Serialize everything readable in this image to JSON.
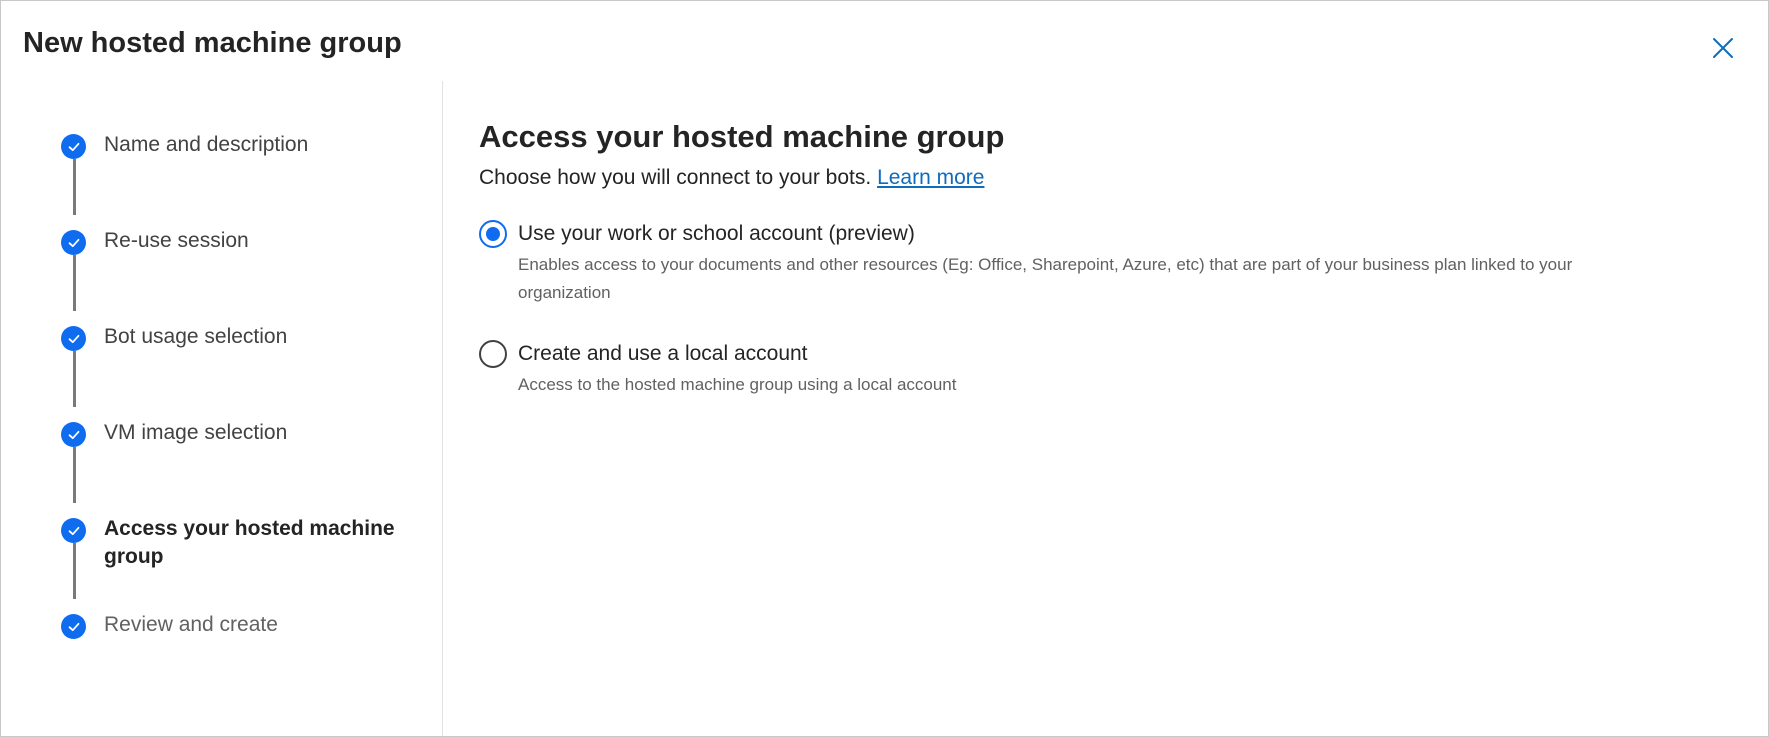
{
  "dialog": {
    "title": "New hosted machine group",
    "close_icon": "close-icon"
  },
  "stepper": {
    "steps": [
      {
        "label": "Name and description",
        "status": "complete"
      },
      {
        "label": "Re-use session",
        "status": "complete"
      },
      {
        "label": "Bot usage selection",
        "status": "complete"
      },
      {
        "label": "VM image selection",
        "status": "complete"
      },
      {
        "label": "Access your hosted machine group",
        "status": "current"
      },
      {
        "label": "Review and create",
        "status": "complete"
      }
    ]
  },
  "main": {
    "title": "Access your hosted machine group",
    "description": "Choose how you will connect to your bots.",
    "learn_more": "Learn more",
    "options": [
      {
        "label": "Use your work or school account (preview)",
        "help": "Enables access to your documents and other resources (Eg: Office, Sharepoint, Azure, etc) that are part of your business plan linked to your organization",
        "selected": true
      },
      {
        "label": "Create and use a local account",
        "help": "Access to the hosted machine group using a local account",
        "selected": false
      }
    ]
  },
  "colors": {
    "accent": "#0f6cf0",
    "link": "#0f6cbd",
    "connector": "#7a7a7a"
  }
}
